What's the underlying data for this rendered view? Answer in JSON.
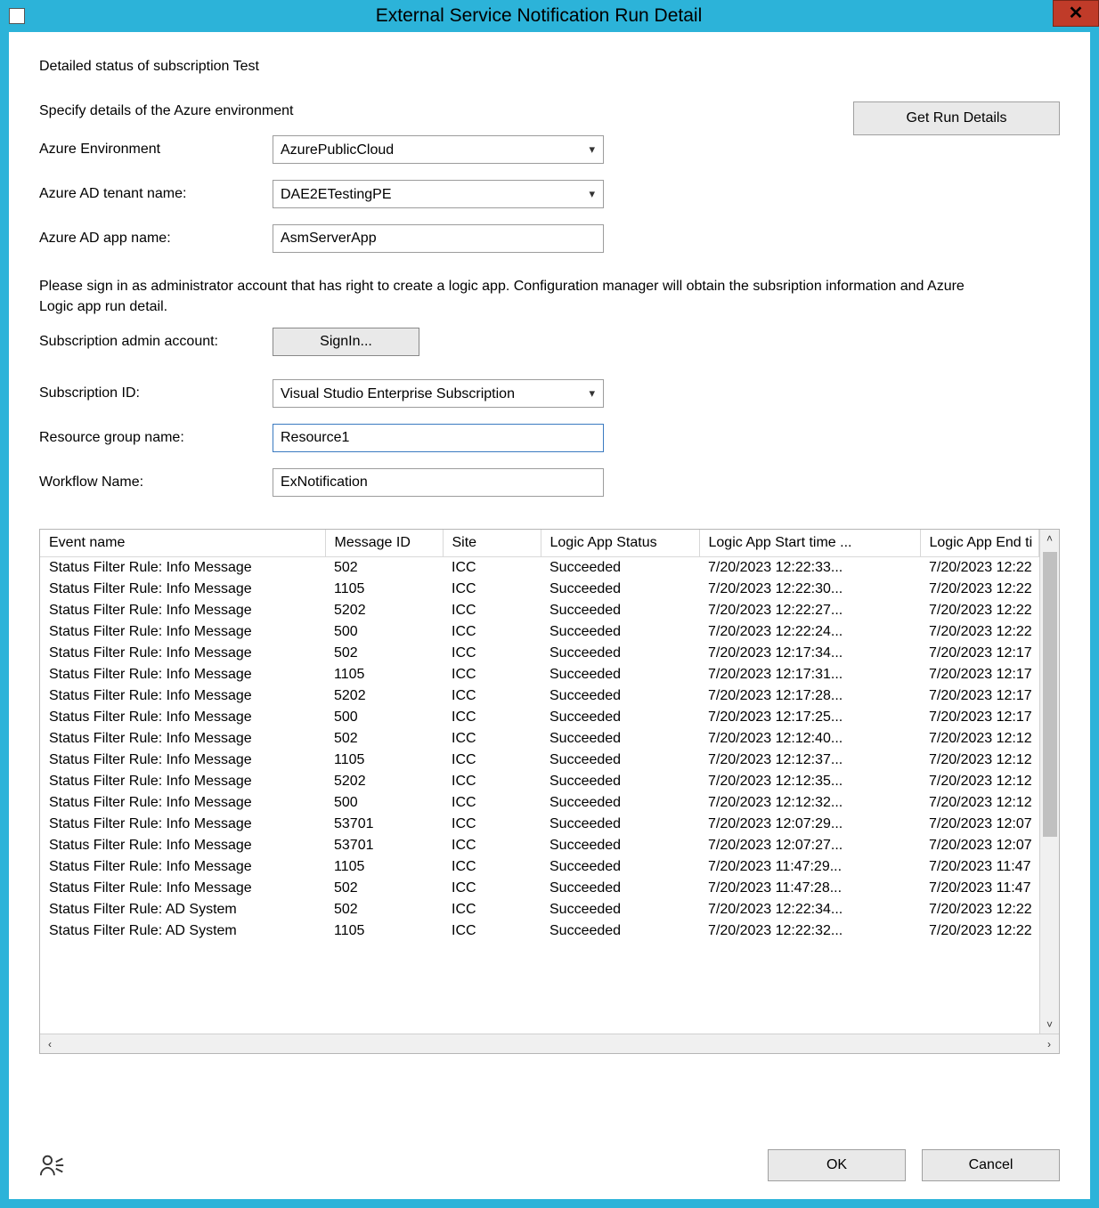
{
  "window": {
    "title": "External Service Notification Run Detail",
    "close_x": "✕"
  },
  "header": {
    "status_line": "Detailed status of subscription Test",
    "specify_line": "Specify details of the Azure environment",
    "get_run_details_label": "Get Run Details"
  },
  "form": {
    "azure_env_label": "Azure Environment",
    "azure_env_value": "AzurePublicCloud",
    "tenant_label": "Azure AD tenant name:",
    "tenant_value": "DAE2ETestingPE",
    "app_label": "Azure AD app name:",
    "app_value": "AsmServerApp",
    "instruction": "Please sign in as administrator account that has right to create a logic app. Configuration manager will obtain the subsription information and Azure Logic app run detail.",
    "admin_label": "Subscription admin account:",
    "signin_label": "SignIn...",
    "sub_id_label": "Subscription ID:",
    "sub_id_value": "Visual Studio Enterprise Subscription",
    "rg_label": "Resource group name:",
    "rg_value": "Resource1",
    "workflow_label": "Workflow Name:",
    "workflow_value": "ExNotification"
  },
  "table": {
    "cols": {
      "event": "Event name",
      "msgid": "Message ID",
      "site": "Site",
      "status": "Logic App Status",
      "start": "Logic App Start time ...",
      "end": "Logic App End ti"
    },
    "rows": [
      {
        "event": "Status Filter Rule: Info Message",
        "msgid": "502",
        "site": "ICC",
        "status": "Succeeded",
        "start": "7/20/2023 12:22:33...",
        "end": "7/20/2023 12:22"
      },
      {
        "event": "Status Filter Rule: Info Message",
        "msgid": "1105",
        "site": "ICC",
        "status": "Succeeded",
        "start": "7/20/2023 12:22:30...",
        "end": "7/20/2023 12:22"
      },
      {
        "event": "Status Filter Rule: Info Message",
        "msgid": "5202",
        "site": "ICC",
        "status": "Succeeded",
        "start": "7/20/2023 12:22:27...",
        "end": "7/20/2023 12:22"
      },
      {
        "event": "Status Filter Rule: Info Message",
        "msgid": "500",
        "site": "ICC",
        "status": "Succeeded",
        "start": "7/20/2023 12:22:24...",
        "end": "7/20/2023 12:22"
      },
      {
        "event": "Status Filter Rule: Info Message",
        "msgid": "502",
        "site": "ICC",
        "status": "Succeeded",
        "start": "7/20/2023 12:17:34...",
        "end": "7/20/2023 12:17"
      },
      {
        "event": "Status Filter Rule: Info Message",
        "msgid": "1105",
        "site": "ICC",
        "status": "Succeeded",
        "start": "7/20/2023 12:17:31...",
        "end": "7/20/2023 12:17"
      },
      {
        "event": "Status Filter Rule: Info Message",
        "msgid": "5202",
        "site": "ICC",
        "status": "Succeeded",
        "start": "7/20/2023 12:17:28...",
        "end": "7/20/2023 12:17"
      },
      {
        "event": "Status Filter Rule: Info Message",
        "msgid": "500",
        "site": "ICC",
        "status": "Succeeded",
        "start": "7/20/2023 12:17:25...",
        "end": "7/20/2023 12:17"
      },
      {
        "event": "Status Filter Rule: Info Message",
        "msgid": "502",
        "site": "ICC",
        "status": "Succeeded",
        "start": "7/20/2023 12:12:40...",
        "end": "7/20/2023 12:12"
      },
      {
        "event": "Status Filter Rule: Info Message",
        "msgid": "1105",
        "site": "ICC",
        "status": "Succeeded",
        "start": "7/20/2023 12:12:37...",
        "end": "7/20/2023 12:12"
      },
      {
        "event": "Status Filter Rule: Info Message",
        "msgid": "5202",
        "site": "ICC",
        "status": "Succeeded",
        "start": "7/20/2023 12:12:35...",
        "end": "7/20/2023 12:12"
      },
      {
        "event": "Status Filter Rule: Info Message",
        "msgid": "500",
        "site": "ICC",
        "status": "Succeeded",
        "start": "7/20/2023 12:12:32...",
        "end": "7/20/2023 12:12"
      },
      {
        "event": "Status Filter Rule: Info Message",
        "msgid": "53701",
        "site": "ICC",
        "status": "Succeeded",
        "start": "7/20/2023 12:07:29...",
        "end": "7/20/2023 12:07"
      },
      {
        "event": "Status Filter Rule: Info Message",
        "msgid": "53701",
        "site": "ICC",
        "status": "Succeeded",
        "start": "7/20/2023 12:07:27...",
        "end": "7/20/2023 12:07"
      },
      {
        "event": "Status Filter Rule: Info Message",
        "msgid": "1105",
        "site": "ICC",
        "status": "Succeeded",
        "start": "7/20/2023 11:47:29...",
        "end": "7/20/2023 11:47"
      },
      {
        "event": "Status Filter Rule: Info Message",
        "msgid": "502",
        "site": "ICC",
        "status": "Succeeded",
        "start": "7/20/2023 11:47:28...",
        "end": "7/20/2023 11:47"
      },
      {
        "event": "Status Filter Rule: AD System",
        "msgid": "502",
        "site": "ICC",
        "status": "Succeeded",
        "start": "7/20/2023 12:22:34...",
        "end": "7/20/2023 12:22"
      },
      {
        "event": "Status Filter Rule: AD System",
        "msgid": "1105",
        "site": "ICC",
        "status": "Succeeded",
        "start": "7/20/2023 12:22:32...",
        "end": "7/20/2023 12:22"
      }
    ]
  },
  "footer": {
    "ok_label": "OK",
    "cancel_label": "Cancel"
  }
}
